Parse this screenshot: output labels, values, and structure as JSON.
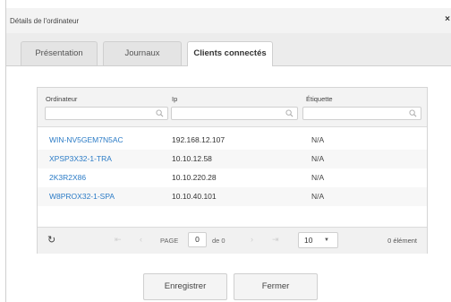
{
  "window": {
    "title": "Détails de l'ordinateur",
    "close": "×"
  },
  "tabs": [
    {
      "label": "Présentation"
    },
    {
      "label": "Journaux"
    },
    {
      "label": "Clients connectés",
      "active": true
    }
  ],
  "grid": {
    "columns": [
      {
        "label": "Ordinateur"
      },
      {
        "label": "Ip"
      },
      {
        "label": "Étiquette"
      }
    ],
    "rows": [
      {
        "ordinateur": "WIN-NV5GEM7N5AC",
        "ip": "192.168.12.107",
        "etiquette": "N/A"
      },
      {
        "ordinateur": "XPSP3X32-1-TRA",
        "ip": "10.10.12.58",
        "etiquette": "N/A"
      },
      {
        "ordinateur": "2K3R2X86",
        "ip": "10.10.220.28",
        "etiquette": "N/A"
      },
      {
        "ordinateur": "W8PROX32-1-SPA",
        "ip": "10.10.40.101",
        "etiquette": "N/A"
      }
    ]
  },
  "pager": {
    "page_label": "PAGE",
    "page_value": "0",
    "of_label": "de 0",
    "page_size": "10",
    "count": "0 élément"
  },
  "buttons": {
    "save": "Enregistrer",
    "close": "Fermer"
  }
}
